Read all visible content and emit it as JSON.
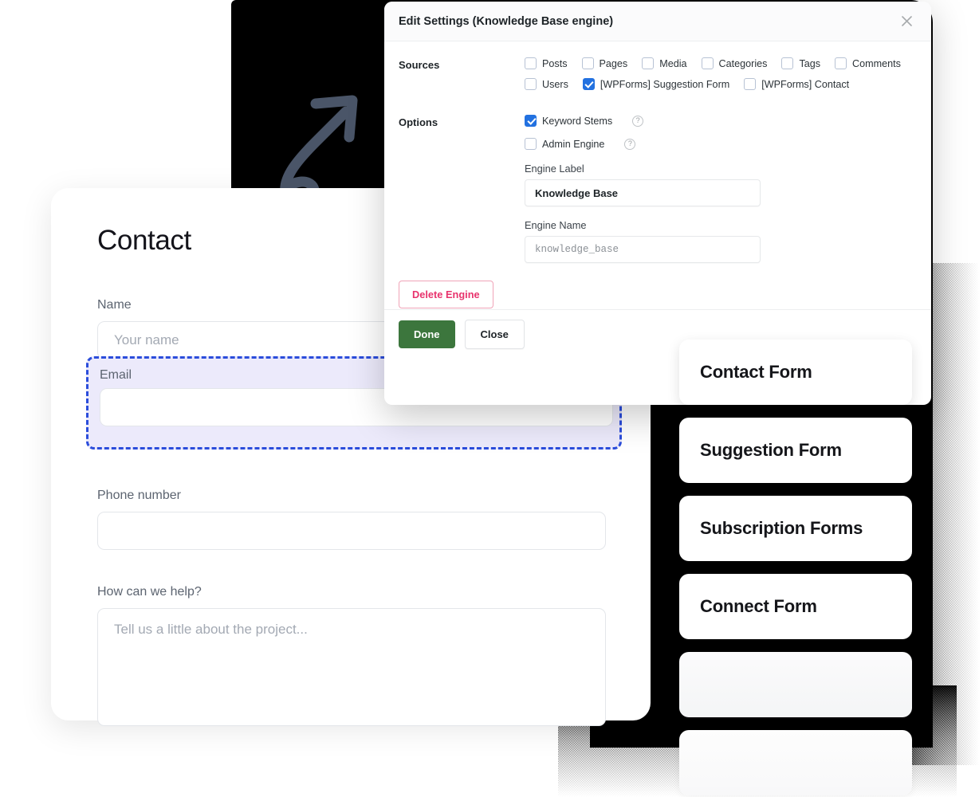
{
  "dialog": {
    "title": "Edit Settings (Knowledge Base engine)",
    "close_icon": "close-icon",
    "sources_label": "Sources",
    "options_label": "Options",
    "sources_row1": [
      {
        "label": "Posts",
        "checked": false
      },
      {
        "label": "Pages",
        "checked": false
      },
      {
        "label": "Media",
        "checked": false
      },
      {
        "label": "Categories",
        "checked": false
      },
      {
        "label": "Tags",
        "checked": false
      },
      {
        "label": "Comments",
        "checked": false
      }
    ],
    "sources_row2": [
      {
        "label": "Users",
        "checked": false
      },
      {
        "label": "[WPForms] Suggestion Form",
        "checked": true
      },
      {
        "label": "[WPForms] Contact",
        "checked": false
      }
    ],
    "options": [
      {
        "label": "Keyword Stems",
        "checked": true,
        "help": "?"
      },
      {
        "label": "Admin Engine",
        "checked": false,
        "help": "?"
      }
    ],
    "engine_label_field": {
      "label": "Engine Label",
      "value": "Knowledge Base"
    },
    "engine_name_field": {
      "label": "Engine Name",
      "value": "",
      "placeholder": "knowledge_base"
    },
    "delete_label": "Delete Engine",
    "done_label": "Done",
    "close_label": "Close",
    "accent_done": "#3c763d",
    "accent_delete": "#e8336d",
    "accent_checkbox": "#2271e0"
  },
  "contact_form": {
    "title": "Contact",
    "fields": [
      {
        "label": "Name",
        "value": "",
        "placeholder": "Your name"
      },
      {
        "label": "Email",
        "value": "",
        "placeholder": ""
      },
      {
        "label": "Phone number",
        "value": "",
        "placeholder": ""
      },
      {
        "label": "How can we help?",
        "value": "",
        "placeholder": "Tell us a little about the project..."
      }
    ],
    "highlight_color": "#2b4ddb"
  },
  "form_list": {
    "cards": [
      {
        "label": "Contact Form"
      },
      {
        "label": "Suggestion Form"
      },
      {
        "label": "Subscription Forms"
      },
      {
        "label": "Connect Form"
      },
      {
        "label": ""
      },
      {
        "label": ""
      }
    ]
  },
  "decoration": {
    "arrow_icon": "curved-arrow-icon",
    "arrow_color": "#4a5568",
    "backdrop_color": "#000000"
  }
}
